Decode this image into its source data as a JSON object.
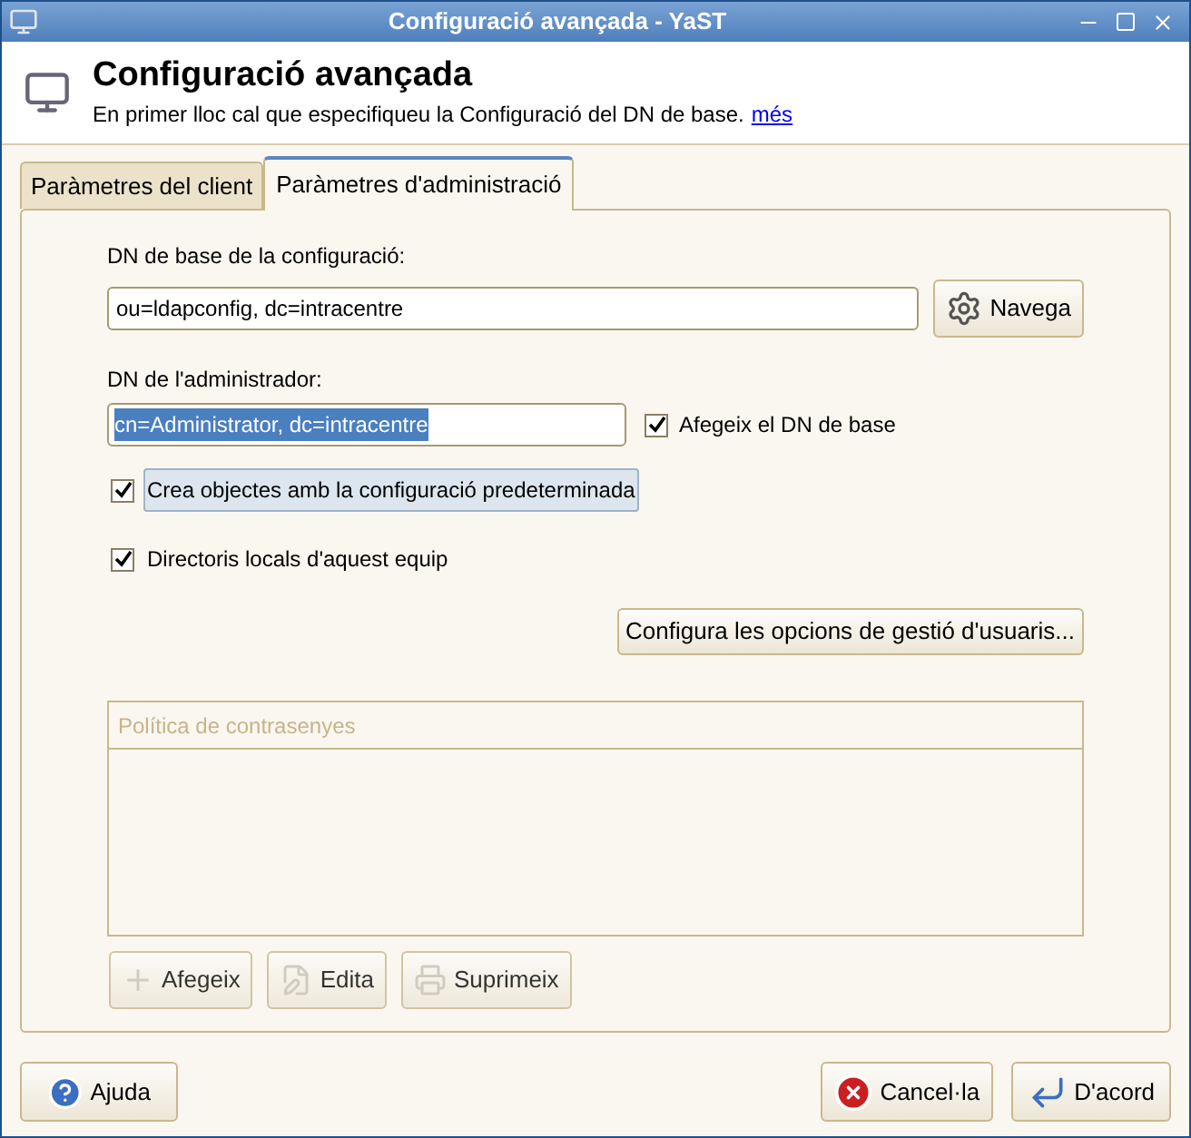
{
  "window": {
    "title": "Configuració avançada - YaST"
  },
  "header": {
    "title": "Configuració avançada",
    "description": "En primer lloc cal que especifiqueu la Configuració del DN de base.",
    "link": "més"
  },
  "tabs": [
    {
      "label": "Paràmetres del client",
      "selected": false
    },
    {
      "label": "Paràmetres d'administració",
      "selected": true
    }
  ],
  "base_dn": {
    "label": "DN de base de la configuració:",
    "value": "ou=ldapconfig, dc=intracentre",
    "browse_button": "Navega"
  },
  "admin_dn": {
    "label": "DN de l'administrador:",
    "value": "cn=Administrator, dc=intracentre",
    "text_selected": true,
    "append_checkbox": {
      "label": "Afegeix el DN de base",
      "checked": true
    }
  },
  "checkboxes": [
    {
      "label": "Crea objectes amb la configuració predeterminada",
      "checked": true,
      "focused": true
    },
    {
      "label": "Directoris locals d'aquest equip",
      "checked": true,
      "focused": false
    }
  ],
  "user_management_button": "Configura les opcions de gestió d'usuaris...",
  "password_policy": {
    "column": "Política de contrasenyes",
    "buttons": [
      {
        "label": "Afegeix",
        "kind": "add",
        "disabled": true
      },
      {
        "label": "Edita",
        "kind": "edit",
        "disabled": true
      },
      {
        "label": "Suprimeix",
        "kind": "delete",
        "disabled": true
      }
    ]
  },
  "footer": {
    "help_button": "Ajuda",
    "cancel_button": "Cancel·la",
    "ok_button": "D'acord"
  }
}
